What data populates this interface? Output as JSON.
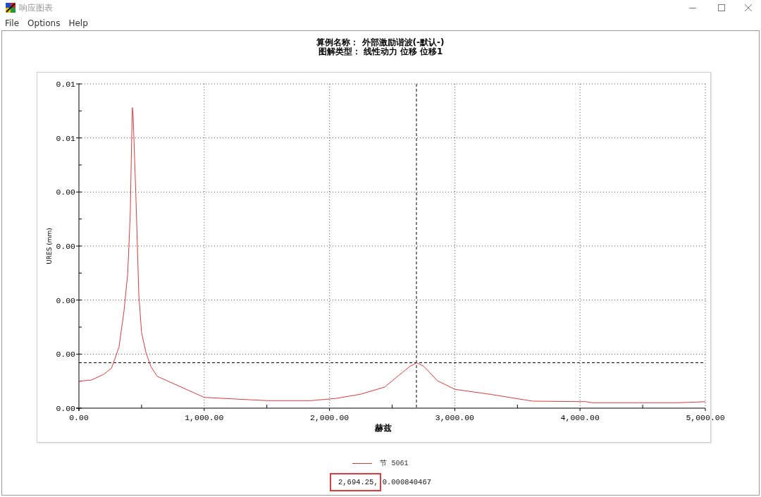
{
  "window": {
    "title": "响应图表"
  },
  "menu": [
    "File",
    "Options",
    "Help"
  ],
  "chart": {
    "chart_data": [
      {
        "type": "line",
        "title": "算例名称： 外部激励谐波(-默认-)",
        "subtitle": "图解类型： 线性动力 位移 位移1",
        "xlabel": "赫兹",
        "ylabel": "URES (mm)",
        "xlim": [
          0,
          5000
        ],
        "ylim": [
          0,
          0.006
        ],
        "xticks": [
          {
            "value": 0,
            "label": "0.00"
          },
          {
            "value": 1000,
            "label": "1,000.00"
          },
          {
            "value": 2000,
            "label": "2,000.00"
          },
          {
            "value": 3000,
            "label": "3,000.00"
          },
          {
            "value": 4000,
            "label": "4,000.00"
          },
          {
            "value": 5000,
            "label": "5,000.00"
          }
        ],
        "yticks": [
          {
            "value": 0,
            "label": "0.00"
          },
          {
            "value": 0.001,
            "label": "0.00"
          },
          {
            "value": 0.002,
            "label": "0.00"
          },
          {
            "value": 0.003,
            "label": "0.00"
          },
          {
            "value": 0.004,
            "label": "0.00"
          },
          {
            "value": 0.005,
            "label": "0.01"
          },
          {
            "value": 0.006,
            "label": "0.01"
          }
        ],
        "grid": true,
        "legend": "bottom",
        "series": [
          {
            "name": "节 5061",
            "color": "#e03a3a",
            "x": [
              0,
              100,
              200,
              260,
              320,
              360,
              390,
              410,
              420,
              427,
              433,
              455,
              478,
              500,
              535,
              575,
              625,
              1000,
              1500,
              1850,
              2050,
              2250,
              2440,
              2550,
              2640,
              2694,
              2750,
              2860,
              3000,
              3300,
              3620,
              4050,
              4100,
              4780,
              5000
            ],
            "values": [
              0.0005,
              0.00052,
              0.00063,
              0.00074,
              0.00113,
              0.0018,
              0.0025,
              0.0036,
              0.0049,
              0.00556,
              0.0054,
              0.0039,
              0.0021,
              0.0014,
              0.00103,
              0.00077,
              0.00059,
              0.0002,
              0.00014,
              0.00014,
              0.00018,
              0.00026,
              0.00039,
              0.0006,
              0.00077,
              0.00084,
              0.00078,
              0.00051,
              0.00035,
              0.00025,
              0.00013,
              0.00012,
              0.0001,
              0.0001,
              0.00012
            ]
          }
        ],
        "ref_lines": [
          {
            "axis": "x",
            "value": 2694.25,
            "color": "#000000",
            "line_style": "dashed"
          },
          {
            "axis": "y",
            "value": 0.000840467,
            "color": "#000000",
            "line_style": "dashed"
          }
        ]
      }
    ]
  },
  "cursor_readout": {
    "x_value": "2,694.25,",
    "y_value": "0.000840467",
    "highlighted": true
  }
}
